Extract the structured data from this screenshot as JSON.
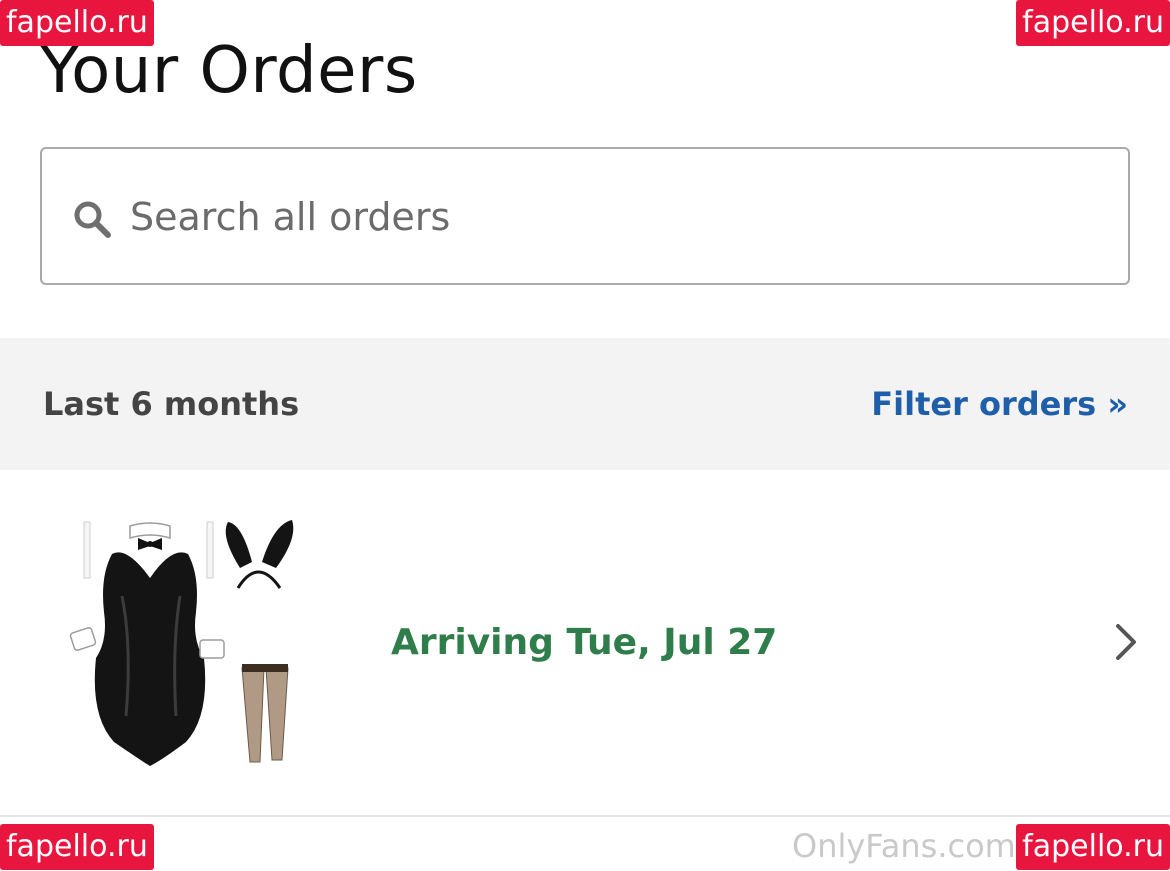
{
  "header": {
    "title": "Your Orders"
  },
  "search": {
    "placeholder": "Search all orders",
    "value": "",
    "icon": "search-icon"
  },
  "filter_bar": {
    "range_label": "Last 6 months",
    "filter_link": "Filter orders »",
    "link_color": "#1f5ea8"
  },
  "orders": [
    {
      "status": "Arriving Tue, Jul 27",
      "status_color": "#2e7d4a",
      "image": "black bunny costume set product photo",
      "chevron_icon": "chevron-right-icon"
    }
  ],
  "overlays": {
    "watermark_text": "fapello.ru",
    "footer_brand": "OnlyFans.com",
    "watermark_color": "#e8163f"
  }
}
